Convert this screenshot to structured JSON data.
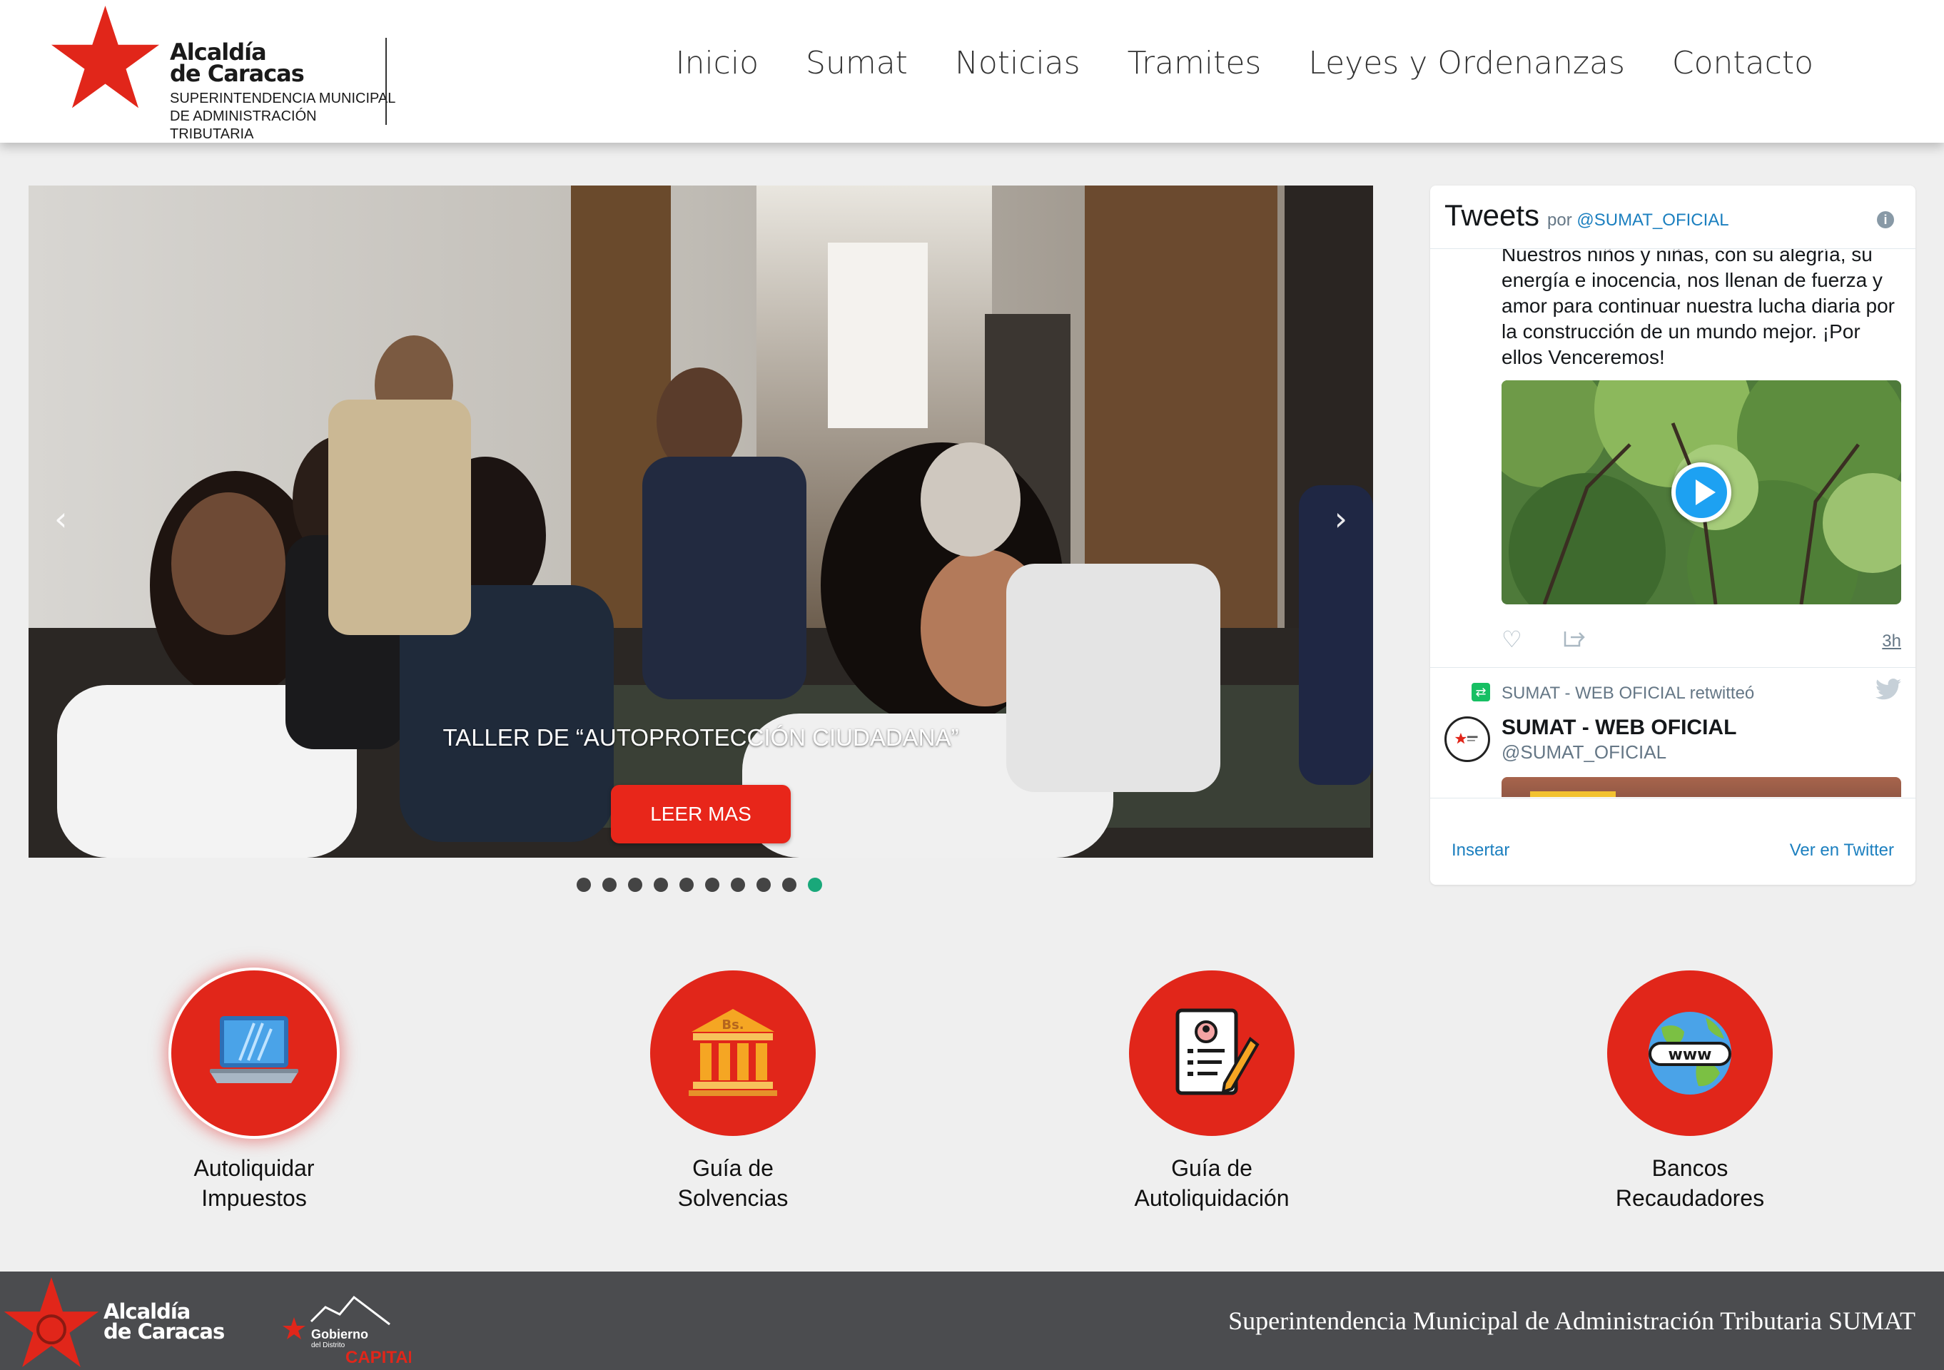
{
  "header": {
    "logo_title_line1": "Alcaldía",
    "logo_title_line2": "de Caracas",
    "logo_sub_line1": "SUPERINTENDENCIA MUNICIPAL",
    "logo_sub_line2": "DE ADMINISTRACIÓN TRIBUTARIA",
    "nav": [
      "Inicio",
      "Sumat",
      "Noticias",
      "Tramites",
      "Leyes y Ordenanzas",
      "Contacto"
    ]
  },
  "carousel": {
    "prev": "‹",
    "next": "›",
    "caption": "TALLER DE “AUTOPROTECCIÓN CIUDADANA”",
    "button_label": "LEER MAS",
    "slide_count": 10,
    "active_slide": 10
  },
  "twitter": {
    "title": "Tweets",
    "by": "por",
    "by_handle": "@SUMAT_OFICIAL",
    "info": "i",
    "tweet_text": "Nuestros niños y niñas, con su alegría, su energía e inocencia, nos llenan de fuerza y amor para continuar nuestra lucha diaria por la construcción de un mundo mejor. ¡Por ellos Venceremos!",
    "like_icon": "heart-icon",
    "share_icon": "share-icon",
    "time": "3h",
    "retweet_text": "SUMAT - WEB OFICIAL retwitteó",
    "name": "SUMAT - WEB OFICIAL",
    "handle": "@SUMAT_OFICIAL",
    "insertar": "Insertar",
    "ver": "Ver en Twitter"
  },
  "features": [
    {
      "line1": "Autoliquidar",
      "line2": "Impuestos",
      "icon": "laptop-icon"
    },
    {
      "line1": "Guía de",
      "line2": "Solvencias",
      "icon": "bank-icon",
      "icon_text": "Bs."
    },
    {
      "line1": "Guía de",
      "line2": "Autoliquidación",
      "icon": "document-pencil-icon"
    },
    {
      "line1": "Bancos",
      "line2": "Recaudadores",
      "icon": "globe-www-icon",
      "icon_text": "www"
    }
  ],
  "footer": {
    "logo_line1": "Alcaldía",
    "logo_line2": "de Caracas",
    "gov_line1": "Gobierno",
    "gov_line2": "del Distrito",
    "gov_line3": "CAPITAL",
    "text": "Superintendencia Municipal de Administración Tributaria SUMAT"
  },
  "colors": {
    "brand_red": "#e1261a",
    "button_red": "#e8261a",
    "active_dot": "#19a87a",
    "twitter_blue": "#1b7fbf",
    "footer_bg": "#4b4c4f"
  }
}
